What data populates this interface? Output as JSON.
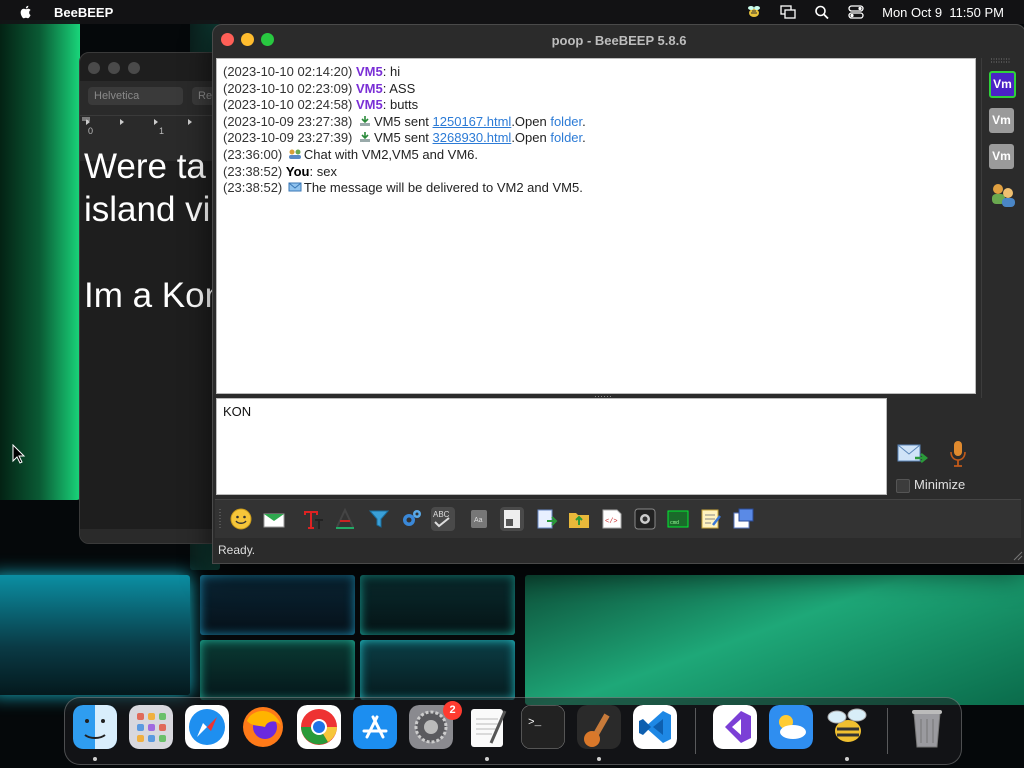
{
  "menubar": {
    "app_name": "BeeBEEP",
    "datetime": "Mon Oct 9  11:50 PM"
  },
  "background_window": {
    "font_name": "Helvetica",
    "style_name": "Re",
    "ruler_ticks": [
      "0",
      "1"
    ],
    "document_text": "Were ta\nisland vi\n\nIm a Kon"
  },
  "window": {
    "title": "poop - BeeBEEP 5.8.6",
    "chat_log": [
      {
        "ts": "(2023-10-10 02:14:20)",
        "who": "VM5",
        "sep": ": ",
        "text": "hi"
      },
      {
        "ts": "(2023-10-10 02:23:09)",
        "who": "VM5",
        "sep": ": ",
        "text": "ASS"
      },
      {
        "ts": "(2023-10-10 02:24:58)",
        "who": "VM5",
        "sep": ": ",
        "text": "butts"
      }
    ],
    "file_lines": [
      {
        "ts": "(2023-10-09 23:27:38)",
        "pre": "VM5 sent ",
        "file": "1250167.html",
        "mid": ".Open ",
        "folder": "folder",
        "end": "."
      },
      {
        "ts": "(2023-10-09 23:27:39)",
        "pre": "VM5 sent ",
        "file": "3268930.html",
        "mid": ".Open ",
        "folder": "folder",
        "end": "."
      }
    ],
    "chat_with": {
      "ts": "(23:36:00)",
      "text": "Chat with VM2,VM5 and VM6."
    },
    "you_line": {
      "ts": "(23:38:52)",
      "who": "You",
      "sep": ": ",
      "text": "sex"
    },
    "delivery": {
      "ts": "(23:38:52)",
      "text": "The message will be delivered to VM2 and VM5."
    },
    "input_value": "KON",
    "minimize_label": "Minimize",
    "status": "Ready.",
    "users": [
      "Vm",
      "Vm",
      "Vm"
    ]
  },
  "dock": {
    "badge_count": "2",
    "apps": [
      "finder",
      "launchpad",
      "safari",
      "firefox",
      "chrome",
      "app-store",
      "system-settings",
      "textedit",
      "terminal",
      "garageband",
      "vscode",
      "visual-studio",
      "weather",
      "beebeep",
      "trash"
    ]
  },
  "colors": {
    "username": "#7a2fd6",
    "link": "#2c7bd6",
    "accent_avatar": "#4b22c6",
    "active_border": "#2fd23a"
  }
}
